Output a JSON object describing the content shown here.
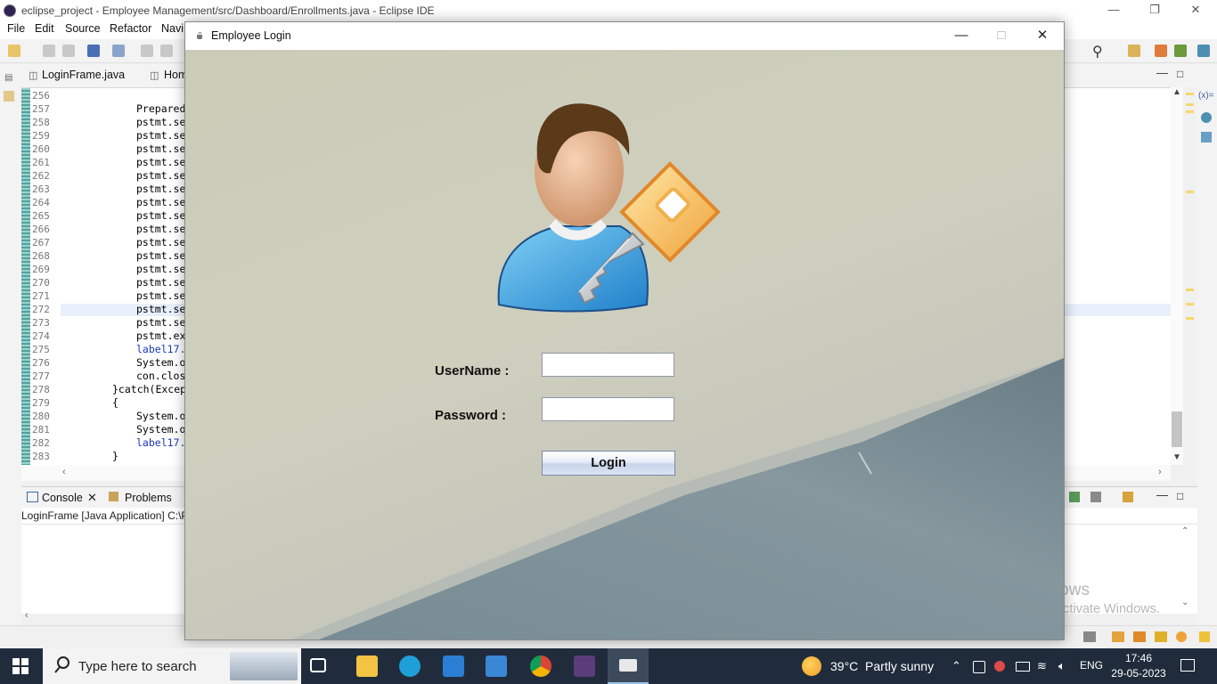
{
  "ide": {
    "title": "eclipse_project - Employee Management/src/Dashboard/Enrollments.java - Eclipse IDE",
    "menu": [
      "File",
      "Edit",
      "Source",
      "Refactor",
      "Navi"
    ],
    "editor_tabs": [
      "LoginFrame.java",
      "Hom"
    ],
    "code_lines": [
      {
        "num": "256",
        "text": ""
      },
      {
        "num": "257",
        "text": "Prepared"
      },
      {
        "num": "258",
        "text": "pstmt.se"
      },
      {
        "num": "259",
        "text": "pstmt.se"
      },
      {
        "num": "260",
        "text": "pstmt.se"
      },
      {
        "num": "261",
        "text": "pstmt.se"
      },
      {
        "num": "262",
        "text": "pstmt.se"
      },
      {
        "num": "263",
        "text": "pstmt.se"
      },
      {
        "num": "264",
        "text": "pstmt.se"
      },
      {
        "num": "265",
        "text": "pstmt.se"
      },
      {
        "num": "266",
        "text": "pstmt.se"
      },
      {
        "num": "267",
        "text": "pstmt.se"
      },
      {
        "num": "268",
        "text": "pstmt.se"
      },
      {
        "num": "269",
        "text": "pstmt.se"
      },
      {
        "num": "270",
        "text": "pstmt.se"
      },
      {
        "num": "271",
        "text": "pstmt.se"
      },
      {
        "num": "272",
        "text": "pstmt.se"
      },
      {
        "num": "273",
        "text": "pstmt.se"
      },
      {
        "num": "274",
        "text": "pstmt.ex"
      },
      {
        "num": "275",
        "text": "label17."
      },
      {
        "num": "276",
        "text": "System.o"
      },
      {
        "num": "277",
        "text": "con.clos"
      },
      {
        "num": "278",
        "text": "}catch(Excep"
      },
      {
        "num": "279",
        "text": "{"
      },
      {
        "num": "280",
        "text": "System.o"
      },
      {
        "num": "281",
        "text": "System.o"
      },
      {
        "num": "282",
        "text": "label17."
      },
      {
        "num": "283",
        "text": "}"
      }
    ],
    "console_tabs": [
      "Console",
      "Problems"
    ],
    "console_path": "LoginFrame [Java Application] C:\\P",
    "watermark_line1": "Activate Windows",
    "watermark_line2": "Go to Settings to activate Windows."
  },
  "dialog": {
    "title": "Employee Login",
    "username_label": "UserName :",
    "password_label": "Password :",
    "username_value": "",
    "password_value": "",
    "login_label": "Login"
  },
  "taskbar": {
    "search_placeholder": "Type here to search",
    "weather": "39°C  Partly sunny",
    "language": "ENG",
    "time": "17:46",
    "date": "29-05-2023"
  },
  "colors": {
    "taskbar_bg": "#202c3c",
    "dialog_bg": "#cbcbb8",
    "login_button": "#c8d4ea"
  }
}
